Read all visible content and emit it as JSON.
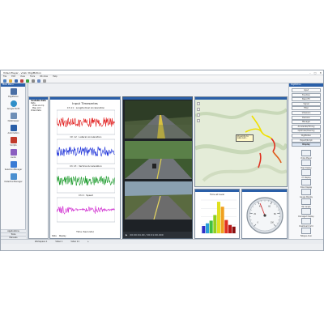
{
  "window": {
    "title": "Video Player - vCalc DigiMotion",
    "controls": [
      "–",
      "□",
      "✕"
    ]
  },
  "menubar": [
    "File",
    "Edit",
    "View",
    "Tools",
    "Window",
    "Help"
  ],
  "left_panel": {
    "header": "Main Menu",
    "items": [
      {
        "label": "DigiMotion",
        "icon": "digimotion-icon",
        "color": "#4a6fa5"
      },
      {
        "label": "Google Earth",
        "icon": "globe-icon",
        "color": "#2f8fc8"
      },
      {
        "label": "DataViewer",
        "icon": "data-viewer-icon",
        "color": "#6f8fb6"
      },
      {
        "label": "Automation",
        "icon": "automation-icon",
        "color": "#2a5fa8"
      },
      {
        "label": "Scripts",
        "icon": "script-icon",
        "color": "#c0392b"
      },
      {
        "label": "Audio",
        "icon": "audio-icon",
        "color": "#8a5ec0"
      },
      {
        "label": "SelectionManager",
        "icon": "selection-icon",
        "color": "#3a7bd5"
      },
      {
        "label": "DetectionManager",
        "icon": "detection-icon",
        "color": "#4a8fd0"
      }
    ],
    "bottom_items": [
      "Applications",
      "Tools",
      "Manuals"
    ]
  },
  "file_tree": {
    "header": "Available Data",
    "lines": [
      "Data",
      "Video ex.mp",
      "Map .kml",
      "Video Data"
    ]
  },
  "timeseries": {
    "title": "Input Timeseries",
    "channels": [
      {
        "label": "Ch 11 : Longitudinal Acceleration",
        "color": "#e01818"
      },
      {
        "label": "Ch 12 : Lateral Acceleration",
        "color": "#1a2fd8"
      },
      {
        "label": "Ch 13 : Vertical Acceleration",
        "color": "#1a9a2a"
      },
      {
        "label": "Ch 4 : Speed",
        "color": "#d02ad0"
      }
    ],
    "xlabel": "Time (Seconds)",
    "tabs": [
      "Data",
      "Display"
    ]
  },
  "video": {
    "time": "00:00:04.00 / 00:01:00.000",
    "play_icon": "play-icon"
  },
  "map_callout": "Proximity to Lake Lan...",
  "bar_chart": {
    "title": "Time at level",
    "chart_data": {
      "type": "bar",
      "categories": [
        "1",
        "2",
        "3",
        "4",
        "5",
        "6",
        "7",
        "8",
        "9"
      ],
      "values": [
        22,
        30,
        38,
        55,
        95,
        80,
        40,
        25,
        20
      ],
      "colors": [
        "#3030c8",
        "#2aa0d8",
        "#40c040",
        "#90d020",
        "#e0e020",
        "#f0a020",
        "#e03020",
        "#b81818",
        "#8a1010"
      ],
      "ylim": [
        0,
        100
      ],
      "grid": true
    }
  },
  "gauge": {
    "value_fraction": 0.42,
    "ticks": [
      "0",
      "20",
      "40",
      "60",
      "80",
      "100"
    ]
  },
  "right_panel": {
    "header": "DigiMotion",
    "buttons": [
      "Input",
      "Function",
      "Basic/FX",
      "Signal",
      "Filter",
      "Video/Lin",
      "Decision",
      "Manager",
      "Accelerate/Timing",
      "Optimize/Clearing",
      "DigiMotion",
      "Export/Script",
      "Display"
    ],
    "selected": "Display",
    "tiles": [
      "Video Player",
      "Map Display",
      "XY Display",
      "Polar Display",
      "Gauge Display",
      "Bar Graph",
      "Damaged Display",
      "Dashboard Grid",
      "Fatigue Anal."
    ]
  },
  "statusbar": [
    "Workspace 1",
    "Video 1",
    "Video 11",
    "+"
  ]
}
